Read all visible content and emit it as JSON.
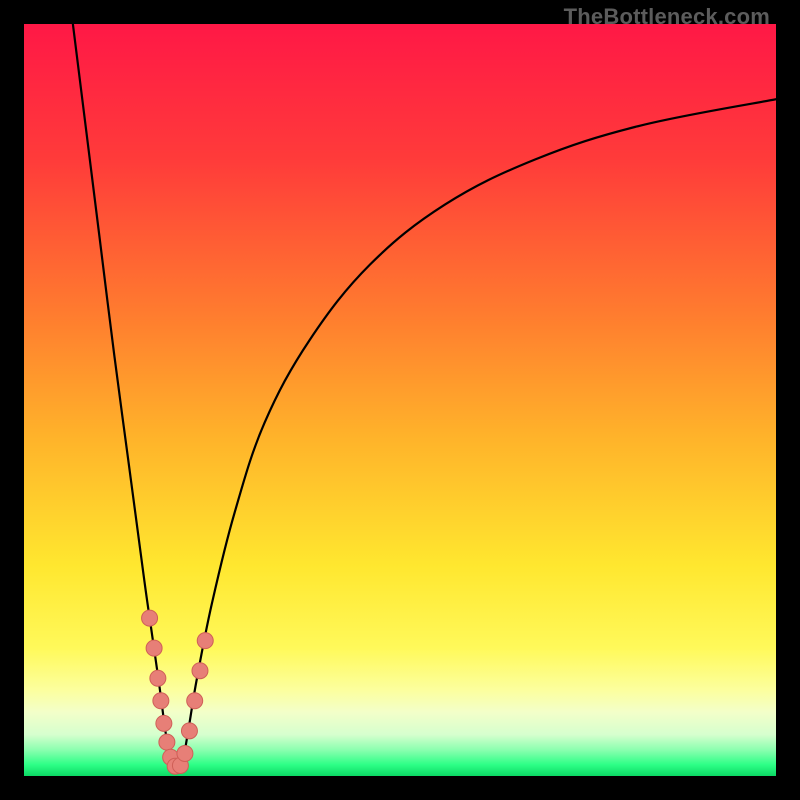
{
  "watermark": {
    "text": "TheBottleneck.com"
  },
  "colors": {
    "frame": "#000000",
    "curve": "#000000",
    "marker_fill": "#e77f77",
    "marker_stroke": "#cf5f57",
    "gradient_stops": [
      {
        "offset": 0.0,
        "color": "#ff1846"
      },
      {
        "offset": 0.18,
        "color": "#ff3b3a"
      },
      {
        "offset": 0.38,
        "color": "#ff7a2f"
      },
      {
        "offset": 0.55,
        "color": "#ffb32a"
      },
      {
        "offset": 0.72,
        "color": "#ffe72f"
      },
      {
        "offset": 0.83,
        "color": "#fff95a"
      },
      {
        "offset": 0.885,
        "color": "#fcff9d"
      },
      {
        "offset": 0.915,
        "color": "#f3ffc9"
      },
      {
        "offset": 0.945,
        "color": "#d6ffce"
      },
      {
        "offset": 0.965,
        "color": "#8cffb0"
      },
      {
        "offset": 0.985,
        "color": "#2dff86"
      },
      {
        "offset": 1.0,
        "color": "#0bd964"
      }
    ]
  },
  "chart_data": {
    "type": "line",
    "title": "",
    "xlabel": "",
    "ylabel": "",
    "xlim": [
      0,
      100
    ],
    "ylim": [
      0,
      100
    ],
    "note": "Axes are implicit (no ticks/labels rendered). x interpreted as horizontal position 0–100 left→right; y interpreted as bottleneck % 0 (bottom, green) → 100 (top, red).",
    "series": [
      {
        "name": "left-branch",
        "x": [
          6.5,
          8,
          10,
          12,
          14,
          16,
          17,
          18,
          18.8,
          19.6
        ],
        "y": [
          100,
          88,
          72,
          56,
          41,
          26,
          19,
          12,
          6,
          1
        ]
      },
      {
        "name": "right-branch",
        "x": [
          21.0,
          22,
          23,
          25,
          28,
          32,
          38,
          46,
          56,
          68,
          82,
          100
        ],
        "y": [
          1,
          7,
          13,
          23,
          35,
          47,
          58,
          68,
          76,
          82,
          86.5,
          90
        ]
      }
    ],
    "markers": {
      "name": "highlighted-points",
      "shape": "circle",
      "radius_px": 8,
      "points": [
        {
          "x": 16.7,
          "y": 21
        },
        {
          "x": 17.3,
          "y": 17
        },
        {
          "x": 17.8,
          "y": 13
        },
        {
          "x": 18.2,
          "y": 10
        },
        {
          "x": 18.6,
          "y": 7
        },
        {
          "x": 19.0,
          "y": 4.5
        },
        {
          "x": 19.5,
          "y": 2.5
        },
        {
          "x": 20.1,
          "y": 1.3
        },
        {
          "x": 20.8,
          "y": 1.4
        },
        {
          "x": 21.4,
          "y": 3.0
        },
        {
          "x": 22.0,
          "y": 6.0
        },
        {
          "x": 22.7,
          "y": 10.0
        },
        {
          "x": 23.4,
          "y": 14.0
        },
        {
          "x": 24.1,
          "y": 18.0
        }
      ]
    }
  }
}
